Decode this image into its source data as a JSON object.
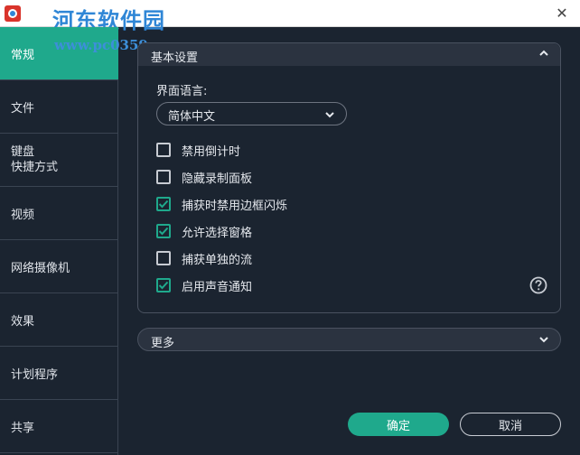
{
  "window": {
    "watermark_title": "河东软件园",
    "watermark_url": "www.pc0359.cn",
    "close_glyph": "✕"
  },
  "sidebar": {
    "items": [
      {
        "label": "常规",
        "active": true
      },
      {
        "label": "文件"
      },
      {
        "label_line1": "键盘",
        "label_line2": "快捷方式"
      },
      {
        "label": "视频"
      },
      {
        "label": "网络摄像机"
      },
      {
        "label": "效果"
      },
      {
        "label": "计划程序"
      },
      {
        "label": "共享"
      }
    ]
  },
  "basic": {
    "title": "基本设置",
    "language_label": "界面语言:",
    "language_value": "简体中文",
    "options": [
      {
        "label": "禁用倒计时",
        "checked": false
      },
      {
        "label": "隐藏录制面板",
        "checked": false
      },
      {
        "label": "捕获时禁用边框闪烁",
        "checked": true
      },
      {
        "label": "允许选择窗格",
        "checked": true
      },
      {
        "label": "捕获单独的流",
        "checked": false
      },
      {
        "label": "启用声音通知",
        "checked": true
      }
    ]
  },
  "more": {
    "label": "更多"
  },
  "buttons": {
    "ok": "确定",
    "cancel": "取消"
  },
  "colors": {
    "accent": "#1fa98c",
    "background": "#1b2430",
    "panel_header": "#2b3340"
  }
}
